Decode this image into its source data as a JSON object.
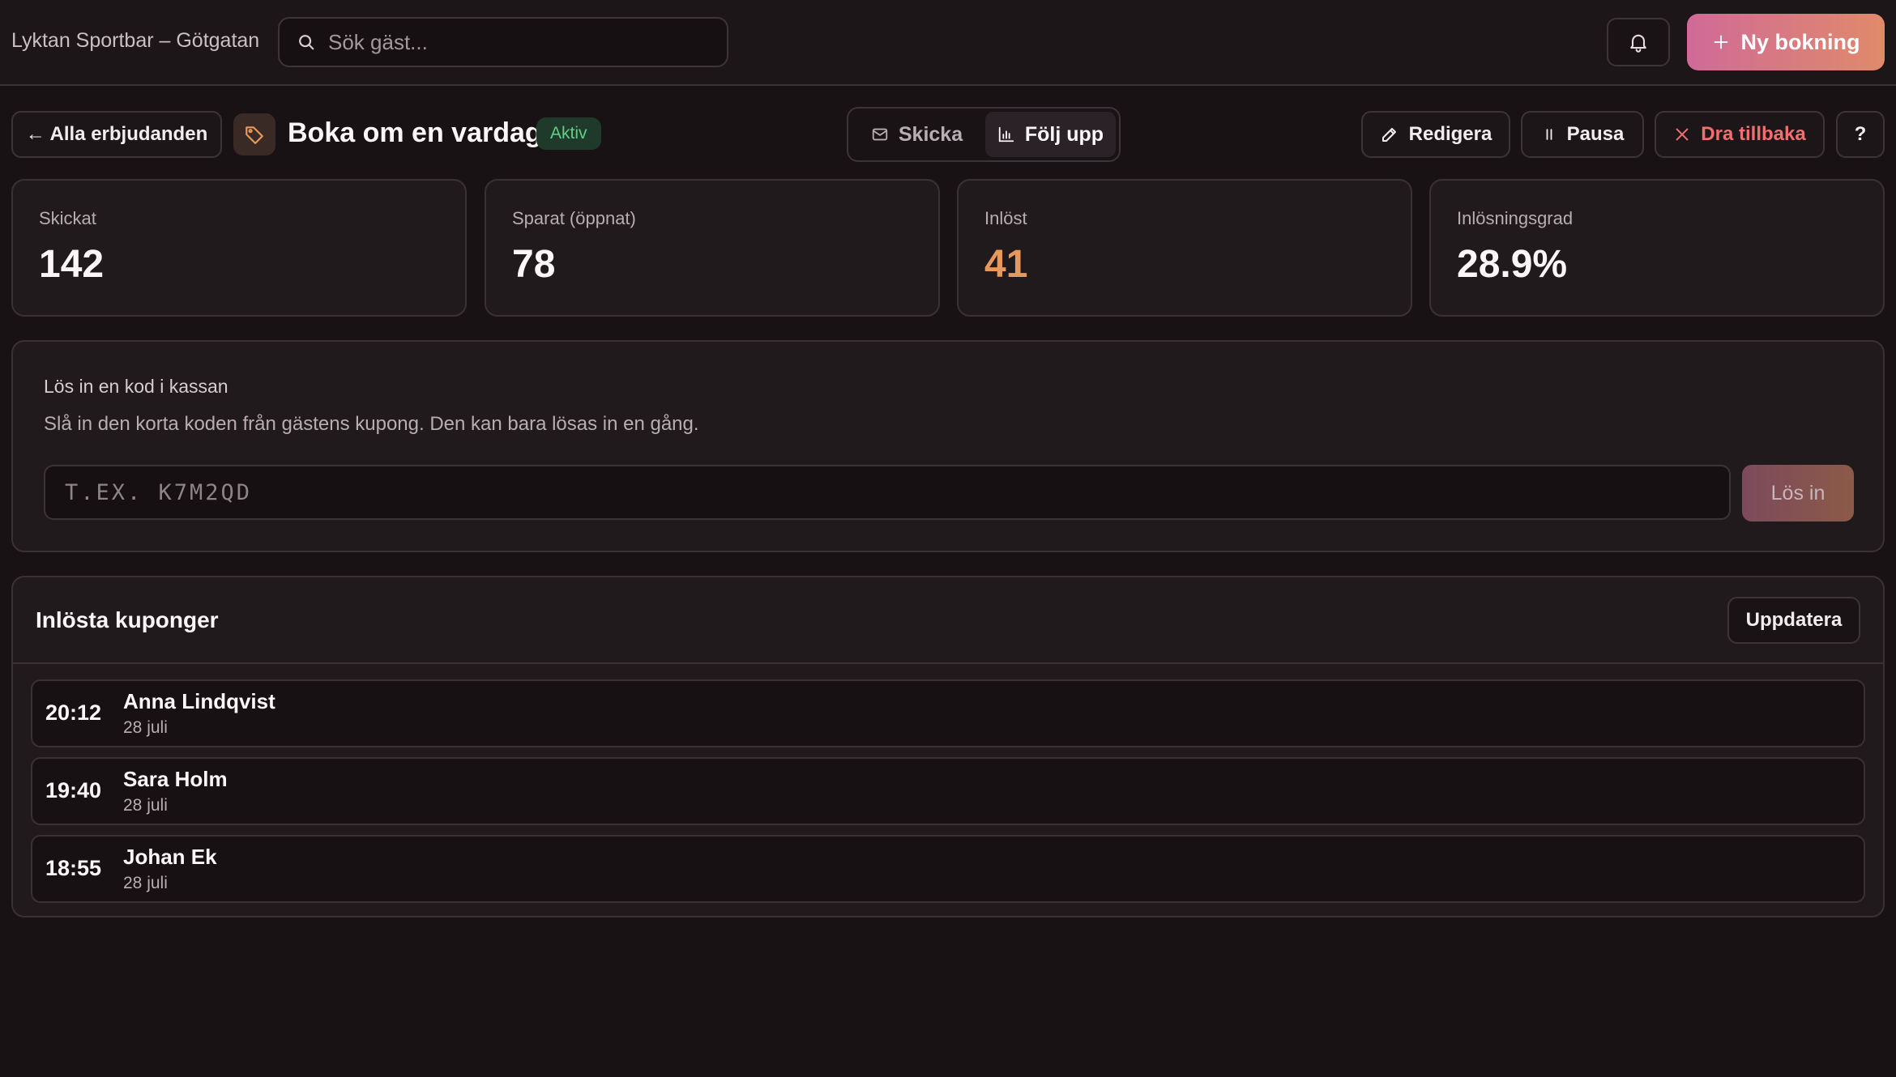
{
  "topbar": {
    "venue": "Lyktan Sportbar – Götgatan",
    "search_placeholder": "Sök gäst...",
    "new_booking_label": "Ny bokning"
  },
  "offer": {
    "back_label": "← Alla erbjudanden",
    "title": "Boka om en vardag",
    "status": "Aktiv",
    "tabs": [
      {
        "label": "Skicka",
        "icon": "mail-icon",
        "active": false
      },
      {
        "label": "Följ upp",
        "icon": "bar-chart-icon",
        "active": true
      }
    ],
    "actions": {
      "edit": "Redigera",
      "pause": "Pausa",
      "withdraw": "Dra tillbaka",
      "help": "?"
    }
  },
  "stats": [
    {
      "label": "Skickat",
      "value": "142"
    },
    {
      "label": "Sparat (öppnat)",
      "value": "78"
    },
    {
      "label": "Inlöst",
      "value": "41"
    },
    {
      "label": "Inlösningsgrad",
      "value": "28.9%"
    }
  ],
  "redeem": {
    "heading": "Lös in en kod i kassan",
    "description": "Slå in den korta koden från gästens kupong. Den kan bara lösas in en gång.",
    "placeholder": "T.EX. K7M2QD",
    "button": "Lös in"
  },
  "redeemed": {
    "title": "Inlösta kuponger",
    "refresh": "Uppdatera",
    "rows": [
      {
        "time": "20:12",
        "name": "Anna Lindqvist",
        "date": "28 juli"
      },
      {
        "time": "19:40",
        "name": "Sara Holm",
        "date": "28 juli"
      },
      {
        "time": "18:55",
        "name": "Johan Ek",
        "date": "28 juli"
      }
    ]
  },
  "colors": {
    "background": "#181214",
    "accent_gradient_start": "#d06a98",
    "accent_gradient_end": "#e08a6a",
    "status_active": "#5fcf86",
    "redeemed_value": "#e6995a",
    "danger": "#f07070"
  }
}
